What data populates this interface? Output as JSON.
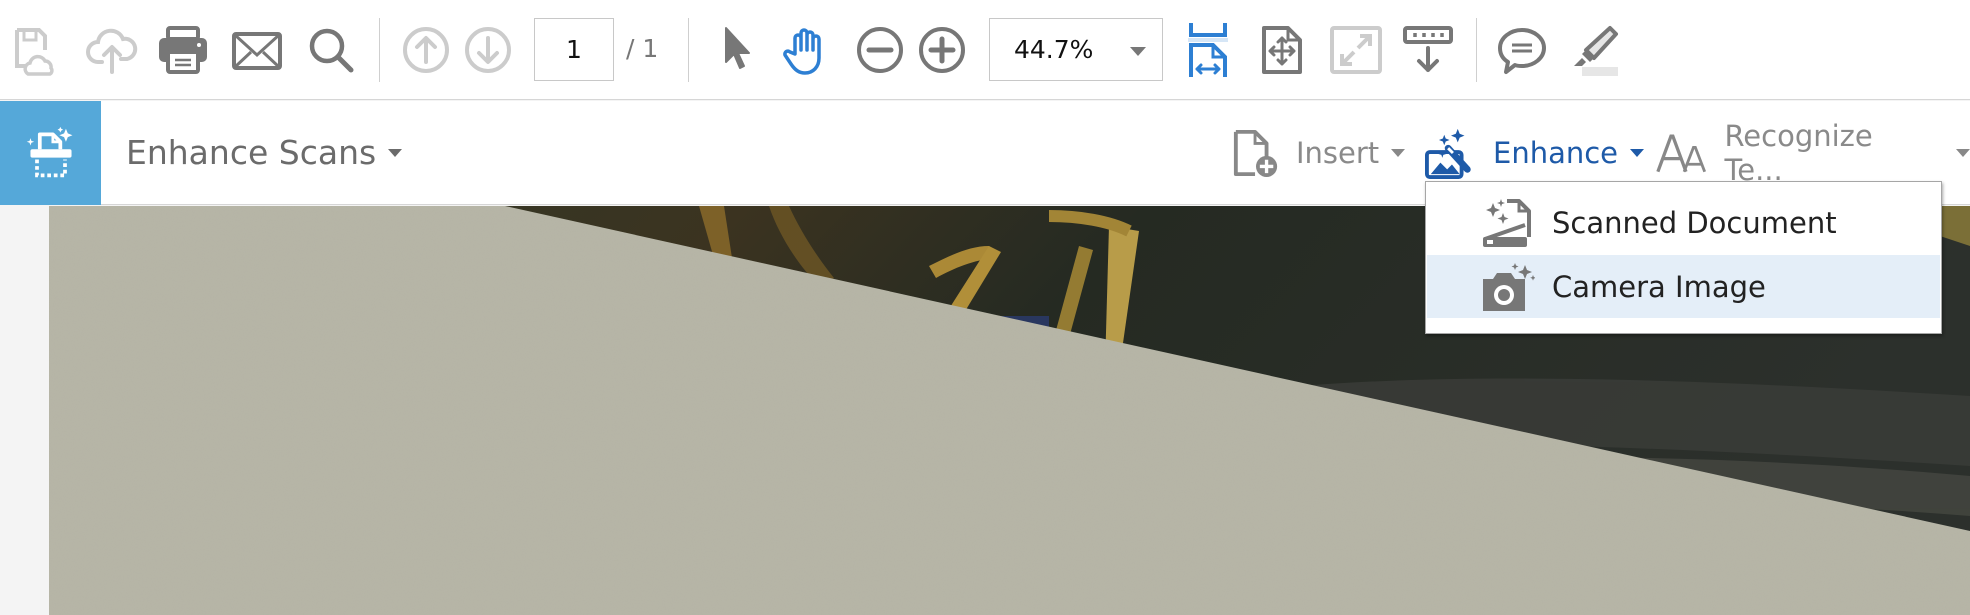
{
  "toolbar": {
    "buttons": [
      {
        "name": "save-cloud",
        "icon": "save-to-cloud-icon",
        "enabled": false
      },
      {
        "name": "upload",
        "icon": "cloud-upload-icon",
        "enabled": false
      },
      {
        "name": "print",
        "icon": "printer-icon",
        "enabled": true
      },
      {
        "name": "email",
        "icon": "envelope-icon",
        "enabled": true
      },
      {
        "name": "search",
        "icon": "search-icon",
        "enabled": true
      },
      {
        "name": "prev-page",
        "icon": "arrow-up-circle-icon",
        "enabled": false
      },
      {
        "name": "next-page",
        "icon": "arrow-down-circle-icon",
        "enabled": false
      },
      {
        "name": "select",
        "icon": "cursor-arrow-icon",
        "enabled": true
      },
      {
        "name": "hand",
        "icon": "hand-tool-icon",
        "enabled": true,
        "active": true
      },
      {
        "name": "zoom-out",
        "icon": "zoom-out-icon",
        "enabled": true
      },
      {
        "name": "zoom-in",
        "icon": "zoom-in-icon",
        "enabled": true
      },
      {
        "name": "scroll-mode",
        "icon": "scrolling-mode-icon",
        "enabled": true,
        "active": true
      },
      {
        "name": "fit-page",
        "icon": "fit-page-icon",
        "enabled": true
      },
      {
        "name": "full-screen",
        "icon": "full-screen-icon",
        "enabled": false
      },
      {
        "name": "keyboard-download",
        "icon": "keyboard-download-icon",
        "enabled": true
      },
      {
        "name": "comment",
        "icon": "comment-bubble-icon",
        "enabled": true
      },
      {
        "name": "highlight",
        "icon": "highlighter-icon",
        "enabled": true
      }
    ],
    "page_current": "1",
    "page_total": "/  1",
    "zoom_level": "44.7%"
  },
  "toolrow": {
    "tool_name": "Enhance Scans",
    "items": [
      {
        "label": "Insert",
        "icon": "insert-page-icon"
      },
      {
        "label": "Enhance",
        "icon": "enhance-magic-wand-icon",
        "active": true
      },
      {
        "label": "Recognize Te...",
        "icon": "recognize-text-icon"
      }
    ]
  },
  "dropdown": {
    "items": [
      {
        "label": "Scanned Document",
        "icon": "scanned-document-icon"
      },
      {
        "label": "Camera Image",
        "icon": "camera-image-icon",
        "hovered": true
      }
    ]
  },
  "colors": {
    "accent_blue": "#2d7fd3",
    "enhance_blue": "#1e5aa8",
    "tool_badge": "#55a8d9",
    "menu_hover": "#e4eef8",
    "icon_gray": "#777777",
    "icon_disabled": "#cccccc"
  }
}
